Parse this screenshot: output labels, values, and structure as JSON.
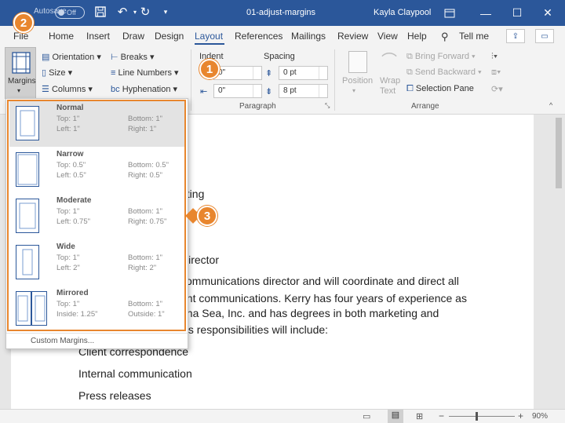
{
  "titlebar": {
    "autosave": "Autosave",
    "autosave_state": "Off",
    "doc_title": "01-adjust-margins",
    "user": "Kayla Claypool"
  },
  "tabs": [
    "File",
    "Home",
    "Insert",
    "Draw",
    "Design",
    "Layout",
    "References",
    "Mailings",
    "Review",
    "View",
    "Help"
  ],
  "tellme": "Tell me",
  "ribbon": {
    "margins": "Margins",
    "orientation": "Orientation",
    "size": "Size",
    "columns": "Columns",
    "breaks": "Breaks",
    "line_numbers": "Line Numbers",
    "hyphenation": "Hyphenation",
    "indent": "Indent",
    "spacing": "Spacing",
    "indent_left": "0\"",
    "indent_right": "0\"",
    "spacing_before": "0 pt",
    "spacing_after": "8 pt",
    "paragraph_group": "Paragraph",
    "position": "Position",
    "wrap_text": "Wrap Text",
    "bring_forward": "Bring Forward",
    "send_backward": "Send Backward",
    "selection_pane": "Selection Pane",
    "arrange_group": "Arrange"
  },
  "margins_menu": {
    "options": [
      {
        "name": "Normal",
        "r1a": "Top:    1\"",
        "r1b": "Bottom: 1\"",
        "r2a": "Left:    1\"",
        "r2b": "Right:  1\""
      },
      {
        "name": "Narrow",
        "r1a": "Top:    0.5\"",
        "r1b": "Bottom: 0.5\"",
        "r2a": "Left:    0.5\"",
        "r2b": "Right:  0.5\""
      },
      {
        "name": "Moderate",
        "r1a": "Top:    1\"",
        "r1b": "Bottom: 1\"",
        "r2a": "Left:    0.75\"",
        "r2b": "Right:  0.75\""
      },
      {
        "name": "Wide",
        "r1a": "Top:    1\"",
        "r1b": "Bottom: 1\"",
        "r2a": "Left:    2\"",
        "r2b": "Right:  2\""
      },
      {
        "name": "Mirrored",
        "r1a": "Top:    1\"",
        "r1b": "Bottom: 1\"",
        "r2a": "Inside:  1.25\"",
        "r2b": "Outside: 1\""
      }
    ],
    "custom": "Custom Margins..."
  },
  "document": {
    "lines": [
      "eting",
      "Director",
      "communications director and will coordinate and direct all",
      "ent communications. Kerry has four years of experience as",
      "una Sea, Inc. and has degrees in both marketing and",
      "y’s responsibilities will include:",
      "Client correspondence",
      "Internal communication",
      "Press releases"
    ]
  },
  "callouts": [
    "1",
    "2",
    "3"
  ],
  "status": {
    "zoom": "90%"
  },
  "colors": {
    "accent": "#2b579a",
    "callout": "#e8862e"
  }
}
